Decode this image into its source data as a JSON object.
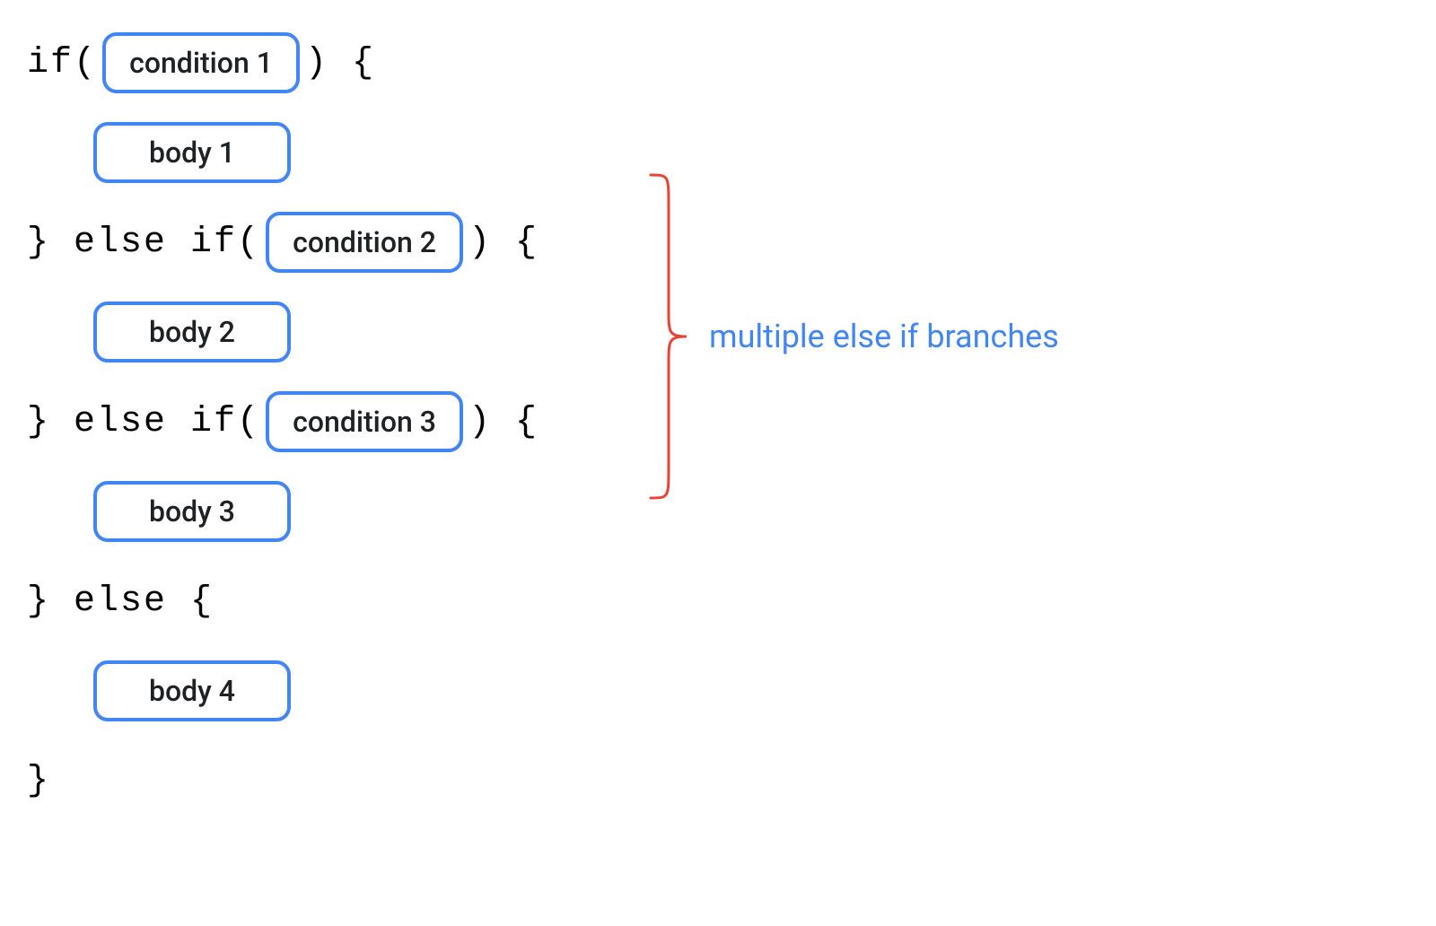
{
  "code": {
    "if_kw": "if(",
    "close_paren_brace": ") {",
    "close_brace_else_if": "} else if(",
    "close_brace_else": "} else {",
    "close_brace": "}"
  },
  "pills": {
    "condition1": "condition 1",
    "body1": "body 1",
    "condition2": "condition 2",
    "body2": "body 2",
    "condition3": "condition 3",
    "body3": "body 3",
    "body4": "body 4"
  },
  "annotation": "multiple else if branches",
  "colors": {
    "pillBorder": "#4285F4",
    "annotationText": "#4285F4",
    "brace": "#EA4335"
  }
}
